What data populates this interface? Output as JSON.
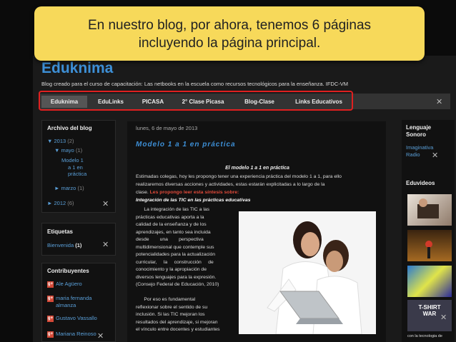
{
  "callout": {
    "line1": "En nuestro blog, por ahora, tenemos 6 páginas",
    "line2": "incluyendo la página principal."
  },
  "blog": {
    "title": "Eduknima",
    "description": "Blog creado para el curso de capacitación: Las netbooks en la escuela como recursos tecnológicos para la enseñanza. IFDC-VM"
  },
  "nav": {
    "items": [
      "Eduknima",
      "EduLinks",
      "PICASA",
      "2° Clase Picasa",
      "Blog-Clase",
      "Links Educativos"
    ],
    "active": "Eduknima"
  },
  "archive": {
    "title": "Archivo del blog",
    "year_2013": "▼ 2013",
    "year_2013_count": "(2)",
    "month_mayo": "▼ mayo",
    "month_mayo_count": "(1)",
    "post_line1": "Modelo 1",
    "post_line2": "a 1 en",
    "post_line3": "práctica",
    "month_marzo": "► marzo",
    "month_marzo_count": "(1)",
    "year_2012": "► 2012",
    "year_2012_count": "(6)"
  },
  "labels_widget": {
    "title": "Etiquetas",
    "item": "Bienvenida",
    "count": "(1)"
  },
  "contributors": {
    "title": "Contribuyentes",
    "names": [
      "Ale Agüero",
      "maria fernanda",
      "almanza",
      "Gustavo Vassallo",
      "Mariana Reinoso"
    ]
  },
  "post": {
    "date": "lunes, 6 de mayo de 2013",
    "title": "Modelo 1 a 1 en práctica",
    "subtitle": "El modelo 1 a 1 en práctica",
    "para1_l1": "Estimadas colegas, hoy les propongo tener una experiencia práctica del modelo 1 a 1, para ello",
    "para1_l2": "realizaremos diversas acciones y actividades, estas estarán explicitadas a lo largo de la",
    "para1_l3_a": "clase. ",
    "para1_l3_red": "Les propongo leer esta síntesis sobre:",
    "para1_l4": "Integración de las TIC en las prácticas educativas",
    "col_lines": [
      "      La integración de las TIC a las",
      "prácticas educativas aporta a la",
      "calidad de la enseñanza y de los",
      "aprendizajes, en tanto sea incluida",
      "desde        una        perspectiva",
      "multidimensional que contemple sus",
      "potencialidades para la actualización",
      "curricular,     la     construcción     de",
      "conocimiento y la apropiación de",
      "diversos lenguajes para la expresión.",
      "(Consejo Federal de Educación, 2010)",
      "",
      "      Por eso es fundamental",
      "reflexionar sobre el sentido de su",
      "inclusión. Si las TIC mejoran los",
      "resultados del aprendizaje, si mejoran",
      "el vínculo entre docentes y estudiantes"
    ]
  },
  "right": {
    "lenguaje_title_l1": "Lenguaje",
    "lenguaje_title_l2": "Sonoro",
    "lenguaje_item_l1": "Imaginativa",
    "lenguaje_item_l2": "Radio",
    "videos_title": "Eduvideos",
    "tshirt_text": "T-SHIRT WAR",
    "video_caption": "con la tecnologia de"
  },
  "colors": {
    "accent": "#3d8fd6",
    "callout": "#f7d95a",
    "highlight": "#e02020"
  }
}
